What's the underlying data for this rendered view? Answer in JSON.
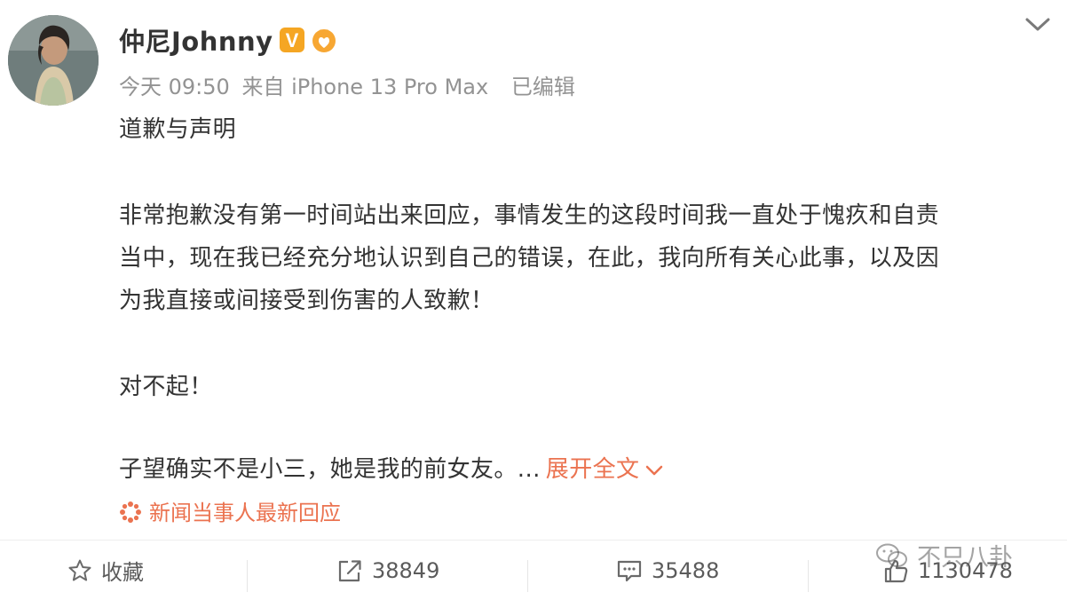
{
  "post": {
    "username": "仲尼Johnny",
    "badge_v": "V",
    "meta": {
      "time": "今天 09:50",
      "source": "来自 iPhone 13 Pro Max",
      "edited": "已编辑"
    },
    "body": {
      "title": "道歉与声明",
      "para1_line1": "非常抱歉没有第一时间站出来回应，事情发生的这段时间我一直处于愧疚和自责",
      "para1_line2": "当中，现在我已经充分地认识到自己的错误，在此，我向所有关心此事，以及因",
      "para1_line3": "为我直接或间接受到伤害的人致歉！",
      "sorry": "对不起！",
      "last_line": "子望确实不是小三，她是我的前女友。...",
      "expand_label": "展开全文"
    },
    "topic": "新闻当事人最新回应"
  },
  "footer": {
    "favorite_label": "收藏",
    "repost_count": "38849",
    "comment_count": "35488",
    "like_count": "1130478"
  },
  "watermark": "不只八卦",
  "colors": {
    "accent": "#eb7350",
    "text": "#333333",
    "meta": "#939393",
    "badge_orange": "#f5a623"
  },
  "icons": {
    "avatar": "avatar",
    "verified": "verified-v-icon",
    "fan_badge": "fan-badge-icon",
    "more": "chevron-down-icon",
    "expand": "chevron-down-icon",
    "topic": "topic-flower-icon",
    "favorite": "star-icon",
    "repost": "repost-icon",
    "comment": "comment-icon",
    "like": "thumbs-up-icon",
    "watermark": "wechat-icon"
  }
}
